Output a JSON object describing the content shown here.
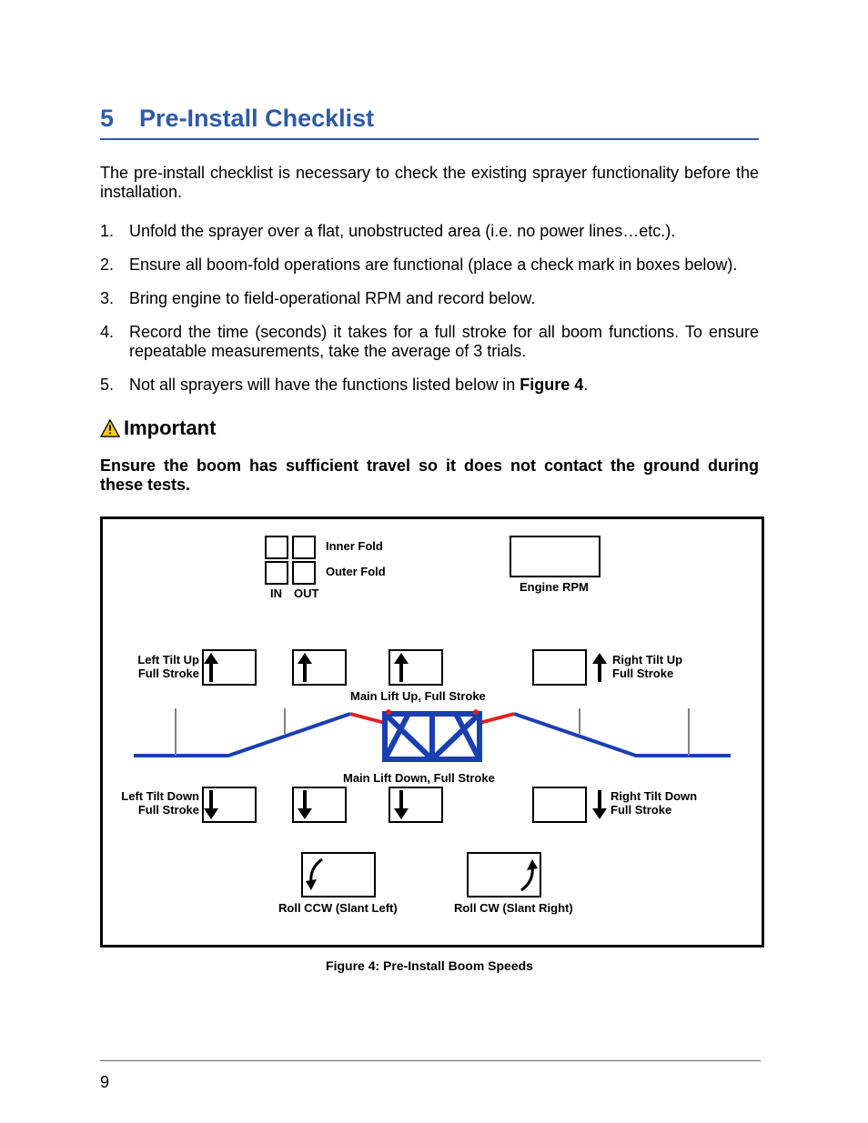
{
  "heading": {
    "number": "5",
    "title": "Pre-Install Checklist"
  },
  "intro": "The pre-install checklist is necessary to check the existing sprayer functionality before the installation.",
  "steps": {
    "n1": "1.",
    "t1": "Unfold the sprayer over a flat, unobstructed area (i.e. no power lines…etc.).",
    "n2": "2.",
    "t2": "Ensure all boom-fold operations are functional (place a check mark in boxes below).",
    "n3": "3.",
    "t3": "Bring engine to field-operational RPM and record below.",
    "n4": "4.",
    "t4a": "Record the time (seconds) it takes for a full stroke for all boom functions.  To ensure repeatable measurements, take the average of 3 trials.",
    "n5": "5.",
    "t5a": "Not all sprayers will have the functions listed below in ",
    "t5b": "Figure 4",
    "t5c": "."
  },
  "important": {
    "label": "Important",
    "body": "Ensure the boom has sufficient travel so it does not contact the ground during these tests."
  },
  "figure": {
    "caption": "Figure 4: Pre-Install Boom Speeds",
    "labels": {
      "inner_fold": "Inner Fold",
      "outer_fold": "Outer Fold",
      "in": "IN",
      "out": "OUT",
      "engine_rpm": "Engine RPM",
      "left_tilt_up": "Left Tilt Up\nFull Stroke",
      "right_tilt_up": "Right Tilt Up\nFull Stroke",
      "main_lift_up": "Main Lift Up, Full Stroke",
      "main_lift_down": "Main Lift Down, Full Stroke",
      "left_tilt_down": "Left Tilt Down\nFull Stroke",
      "right_tilt_down": "Right Tilt Down\nFull Stroke",
      "roll_ccw": "Roll CCW (Slant Left)",
      "roll_cw": "Roll CW (Slant Right)"
    }
  },
  "page_number": "9"
}
